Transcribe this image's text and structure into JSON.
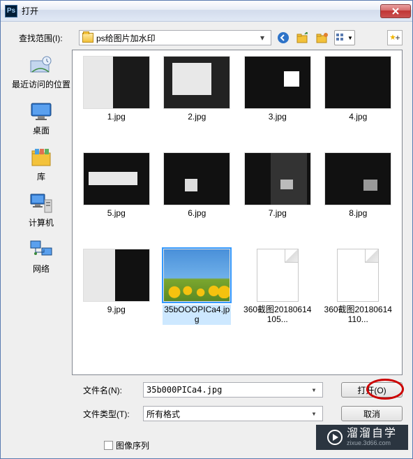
{
  "title": "打开",
  "lookin_label": "查找范围(I):",
  "current_folder": "ps给图片加水印",
  "sidebar": [
    {
      "label": "最近访问的位置"
    },
    {
      "label": "桌面"
    },
    {
      "label": "库"
    },
    {
      "label": "计算机"
    },
    {
      "label": "网络"
    }
  ],
  "files": [
    {
      "name": "1.jpg",
      "kind": "img"
    },
    {
      "name": "2.jpg",
      "kind": "img"
    },
    {
      "name": "3.jpg",
      "kind": "img"
    },
    {
      "name": "4.jpg",
      "kind": "img"
    },
    {
      "name": "5.jpg",
      "kind": "img"
    },
    {
      "name": "6.jpg",
      "kind": "img"
    },
    {
      "name": "7.jpg",
      "kind": "img"
    },
    {
      "name": "8.jpg",
      "kind": "img"
    },
    {
      "name": "9.jpg",
      "kind": "img"
    },
    {
      "name": "35bOOOPICa4.jpg",
      "kind": "img",
      "selected": true
    },
    {
      "name": "360截图20180614105...",
      "kind": "file"
    },
    {
      "name": "360截图20180614110...",
      "kind": "file"
    }
  ],
  "filename_label": "文件名(N):",
  "filename_value": "35b000PICa4.jpg",
  "filetype_label": "文件类型(T):",
  "filetype_value": "所有格式",
  "btn_open": "打开(O)",
  "btn_cancel": "取消",
  "image_seq_label": "图像序列",
  "watermark_main": "溜溜自学",
  "watermark_sub": "zixue.3d66.com"
}
